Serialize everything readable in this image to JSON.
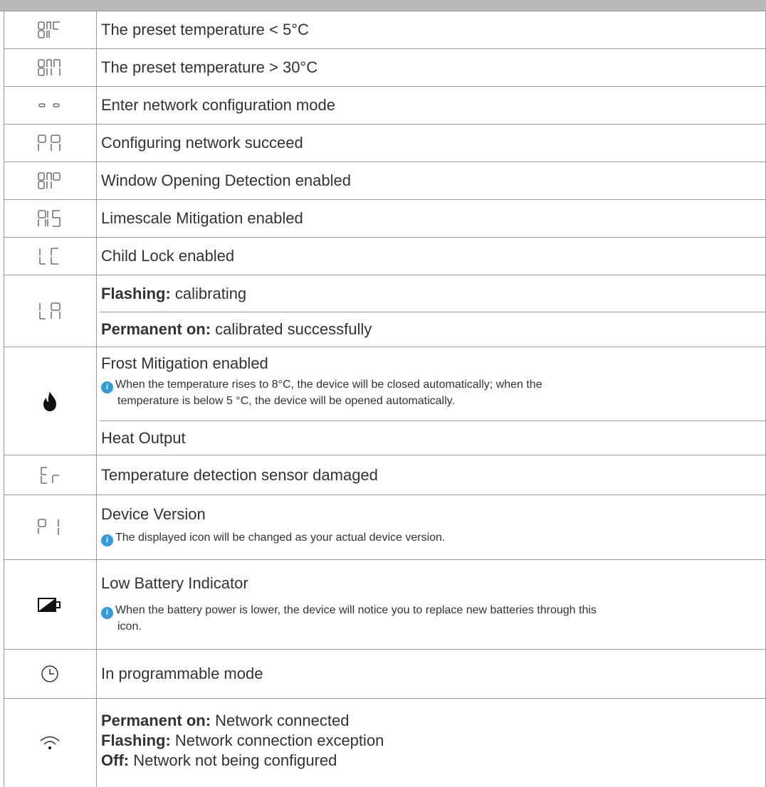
{
  "rows": [
    {
      "icon": "segment-display-off-icon",
      "text": "The preset temperature < 5°C"
    },
    {
      "icon": "segment-display-on-icon",
      "text": "The preset temperature > 30°C"
    },
    {
      "icon": "double-dash-icon",
      "text": "Enter network configuration mode"
    },
    {
      "icon": "segment-display-pa-icon",
      "text": "Configuring network succeed"
    },
    {
      "icon": "segment-display-op-icon",
      "text": "Window Opening Detection enabled"
    },
    {
      "icon": "segment-display-as-icon",
      "text": "Limescale Mitigation enabled"
    },
    {
      "icon": "segment-display-lc-icon",
      "text": "Child Lock enabled"
    },
    {
      "icon": "segment-display-la-icon",
      "lines": [
        {
          "label": "Flashing:",
          "text": " calibrating"
        },
        {
          "label": "Permanent on:",
          "text": " calibrated successfully"
        }
      ]
    },
    {
      "icon": "flame-icon",
      "text": "Frost Mitigation enabled",
      "note": "When the temperature rises to 8°C, the device will be closed automatically; when the",
      "note_cont": "temperature is below 5 °C, the device will be opened automatically.",
      "extra": "Heat Output"
    },
    {
      "icon": "segment-display-er-icon",
      "text": "Temperature detection sensor damaged"
    },
    {
      "icon": "segment-display-p1-icon",
      "text": "Device Version",
      "note": "The displayed icon will be changed as your actual device version."
    },
    {
      "icon": "low-battery-icon",
      "text": "Low Battery Indicator",
      "note": "When the battery power is lower, the device will notice you to replace new batteries through this",
      "note_cont": "icon."
    },
    {
      "icon": "clock-icon",
      "text": "In programmable mode"
    },
    {
      "icon": "wifi-icon",
      "lines": [
        {
          "label": "Permanent on:",
          "text": " Network connected"
        },
        {
          "label": "Flashing:",
          "text": " Network connection exception"
        },
        {
          "label": "Off:",
          "text": " Network not being configured"
        }
      ]
    }
  ],
  "info_glyph": "i"
}
